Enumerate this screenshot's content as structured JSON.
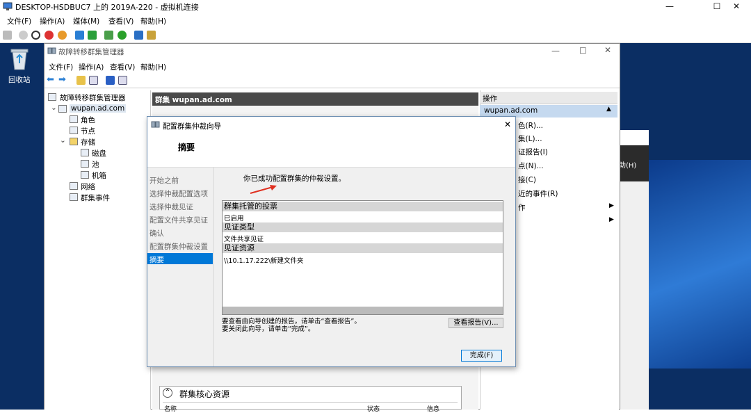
{
  "vm": {
    "title": "DESKTOP-HSDBUC7 上的 2019A-220 - 虚拟机连接",
    "menu": [
      "文件(F)",
      "操作(A)",
      "媒体(M)",
      "查看(V)",
      "帮助(H)"
    ],
    "controls": {
      "minimize": "—",
      "maximize": "☐",
      "close": "✕"
    }
  },
  "desktop": {
    "recycle_bin": "回收站"
  },
  "fcm": {
    "title": "故障转移群集管理器",
    "menu": [
      "文件(F)",
      "操作(A)",
      "查看(V)",
      "帮助(H)"
    ],
    "tree": {
      "root": "故障转移群集管理器",
      "cluster": "wupan.ad.com",
      "items": [
        "角色",
        "节点",
        "存储",
        "磁盘",
        "池",
        "机箱",
        "网络",
        "群集事件"
      ]
    },
    "center_header": "群集 wupan.ad.com",
    "core_resources": {
      "title": "群集核心资源",
      "columns": [
        "名称",
        "状态",
        "信息"
      ]
    },
    "actions": {
      "header": "操作",
      "subheader": "wupan.ad.com",
      "items": [
        "色(R)...",
        "集(L)...",
        "证报告(I)",
        "点(N)...",
        "接(C)",
        "近的事件(R)",
        "作",
        ""
      ]
    }
  },
  "bgwin": {
    "menu_fragment": "助(H)"
  },
  "dialog": {
    "title": "配置群集仲裁向导",
    "heading": "摘要",
    "steps": [
      "开始之前",
      "选择仲裁配置选项",
      "选择仲裁见证",
      "配置文件共享见证",
      "确认",
      "配置群集仲裁设置",
      "摘要"
    ],
    "message": "你已成功配置群集的仲裁设置。",
    "report": [
      {
        "header": "群集托管的投票",
        "value": "已启用"
      },
      {
        "header": "见证类型",
        "value": "文件共享见证"
      },
      {
        "header": "见证资源",
        "value": "\\\\10.1.17.222\\新建文件夹"
      }
    ],
    "hint_line1": "要查看由向导创建的报告，请单击“查看报告”。",
    "hint_line2": "要关闭此向导，请单击“完成”。",
    "view_report_button": "查看报告(V)...",
    "finish_button": "完成(F)",
    "close_glyph": "✕"
  }
}
